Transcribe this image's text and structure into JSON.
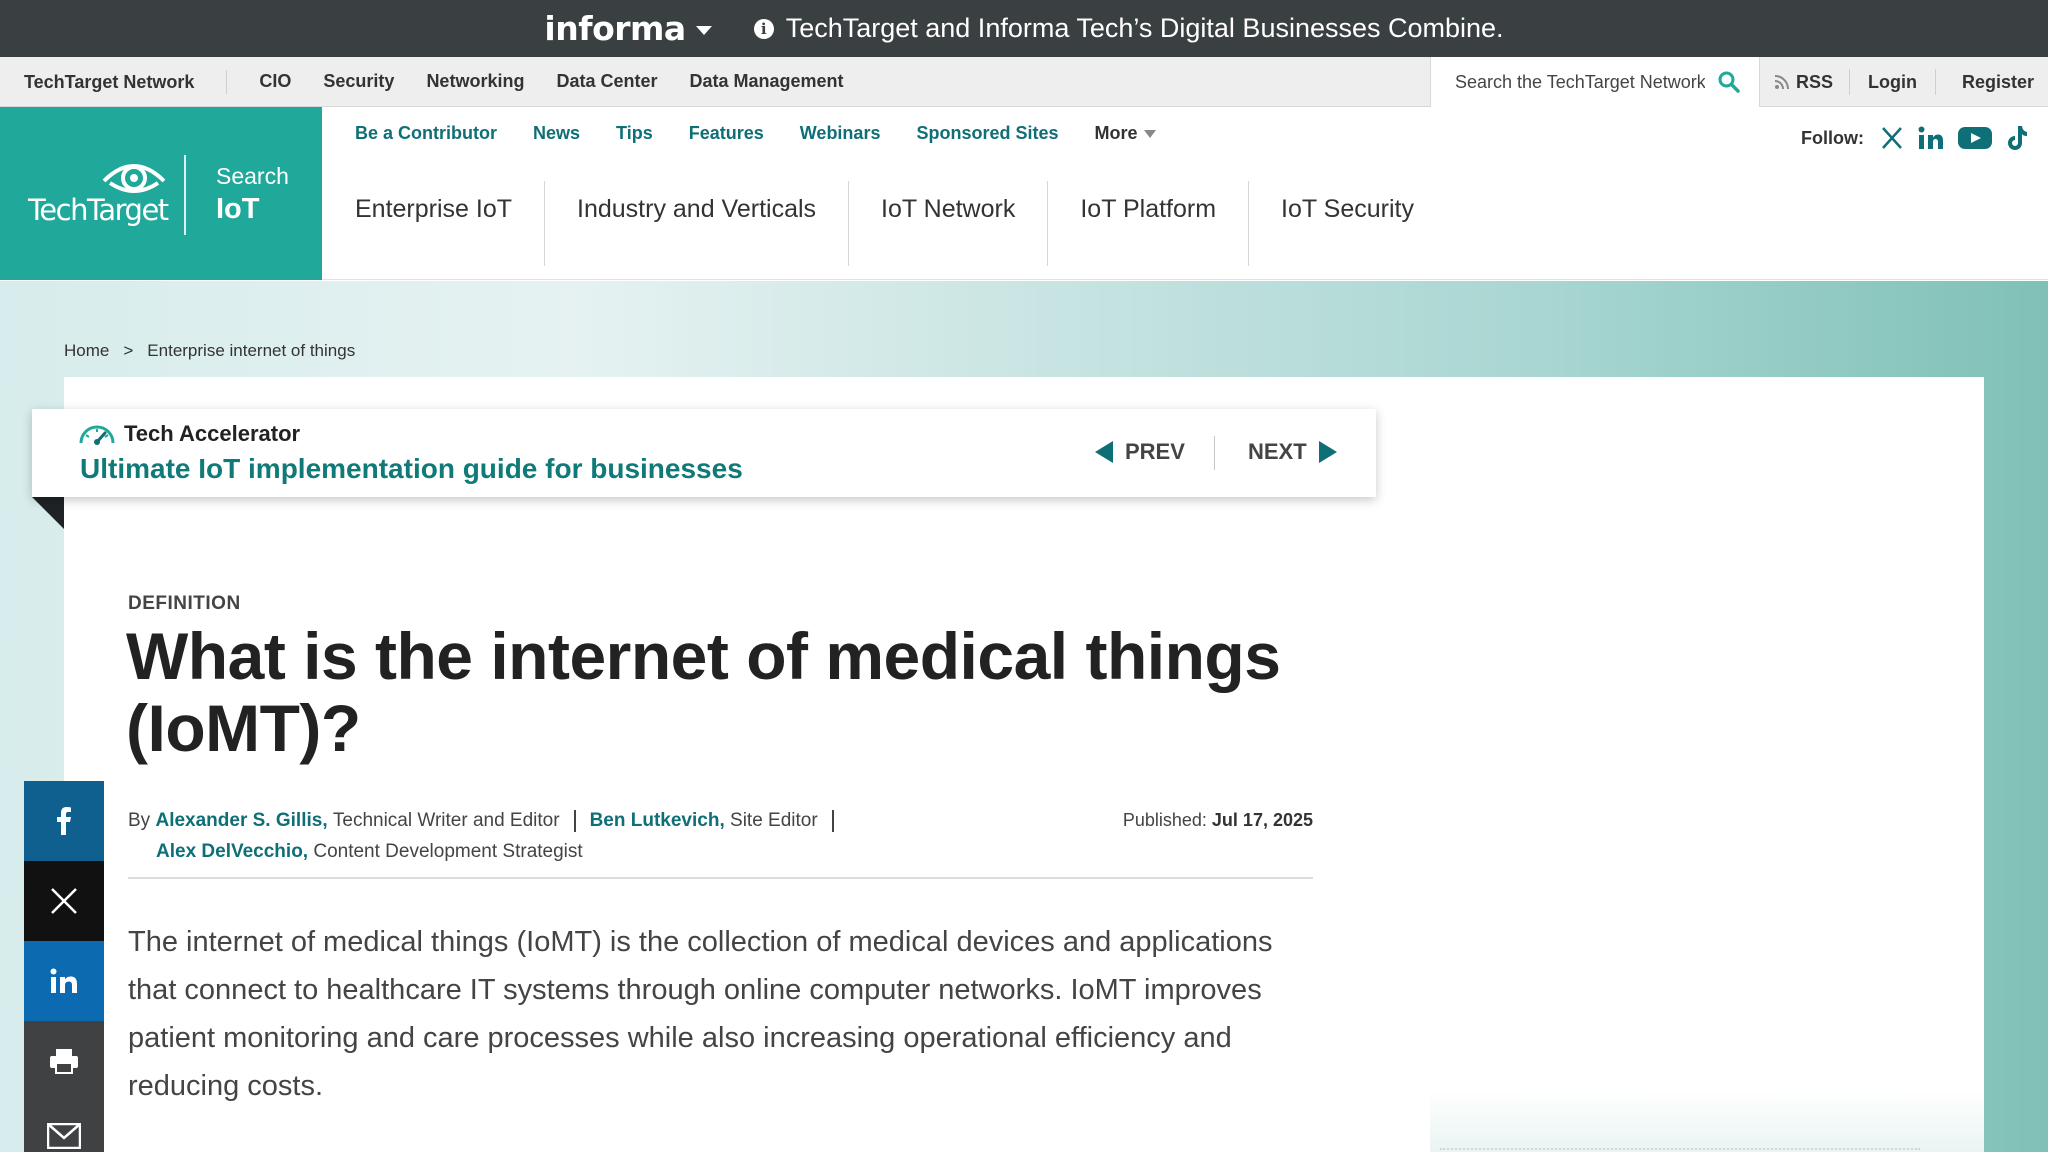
{
  "informa_bar": {
    "logo": "informa",
    "message": "TechTarget and Informa Tech’s Digital Businesses Combine."
  },
  "network_bar": {
    "brand": "TechTarget Network",
    "links": [
      "CIO",
      "Security",
      "Networking",
      "Data Center",
      "Data Management"
    ],
    "search_placeholder": "Search the TechTarget Network",
    "rss": "RSS",
    "login": "Login",
    "register": "Register"
  },
  "site_header": {
    "logo_word": "TechTarget",
    "logo_search": "Search",
    "logo_site": "IoT",
    "sub_links": [
      "Be a Contributor",
      "News",
      "Tips",
      "Features",
      "Webinars",
      "Sponsored Sites",
      "More"
    ],
    "main_nav": [
      "Enterprise IoT",
      "Industry and Verticals",
      "IoT Network",
      "IoT Platform",
      "IoT Security"
    ],
    "follow_label": "Follow:",
    "social_icons": [
      "x-icon",
      "linkedin-icon",
      "youtube-icon",
      "tiktok-icon"
    ]
  },
  "breadcrumb": {
    "home": "Home",
    "separator": ">",
    "current": "Enterprise internet of things"
  },
  "tech_accelerator": {
    "label": "Tech Accelerator",
    "title": "Ultimate IoT implementation guide for businesses",
    "prev": "PREV",
    "next": "NEXT"
  },
  "article": {
    "type": "DEFINITION",
    "title": "What is the internet of medical things (IoMT)?",
    "by": "By",
    "authors": [
      {
        "name": "Alexander S. Gillis,",
        "role": "Technical Writer and Editor"
      },
      {
        "name": "Ben Lutkevich,",
        "role": "Site Editor"
      },
      {
        "name": "Alex DelVecchio,",
        "role": "Content Development Strategist"
      }
    ],
    "published_label": "Published:",
    "published_date": "Jul 17, 2025",
    "lead": "The internet of medical things (IoMT) is the collection of medical devices and applications that connect to healthcare IT systems through online computer networks. IoMT improves patient monitoring and care processes while also increasing operational efficiency and reducing costs."
  },
  "share_rail": [
    "facebook-icon",
    "x-icon",
    "linkedin-icon",
    "print-icon",
    "email-icon"
  ],
  "colors": {
    "brand_teal": "#20a89a",
    "link_teal": "#0f6f77",
    "informa_bar": "#3a3f42",
    "facebook": "#0f5f8f",
    "linkedin": "#0c6bb0"
  }
}
